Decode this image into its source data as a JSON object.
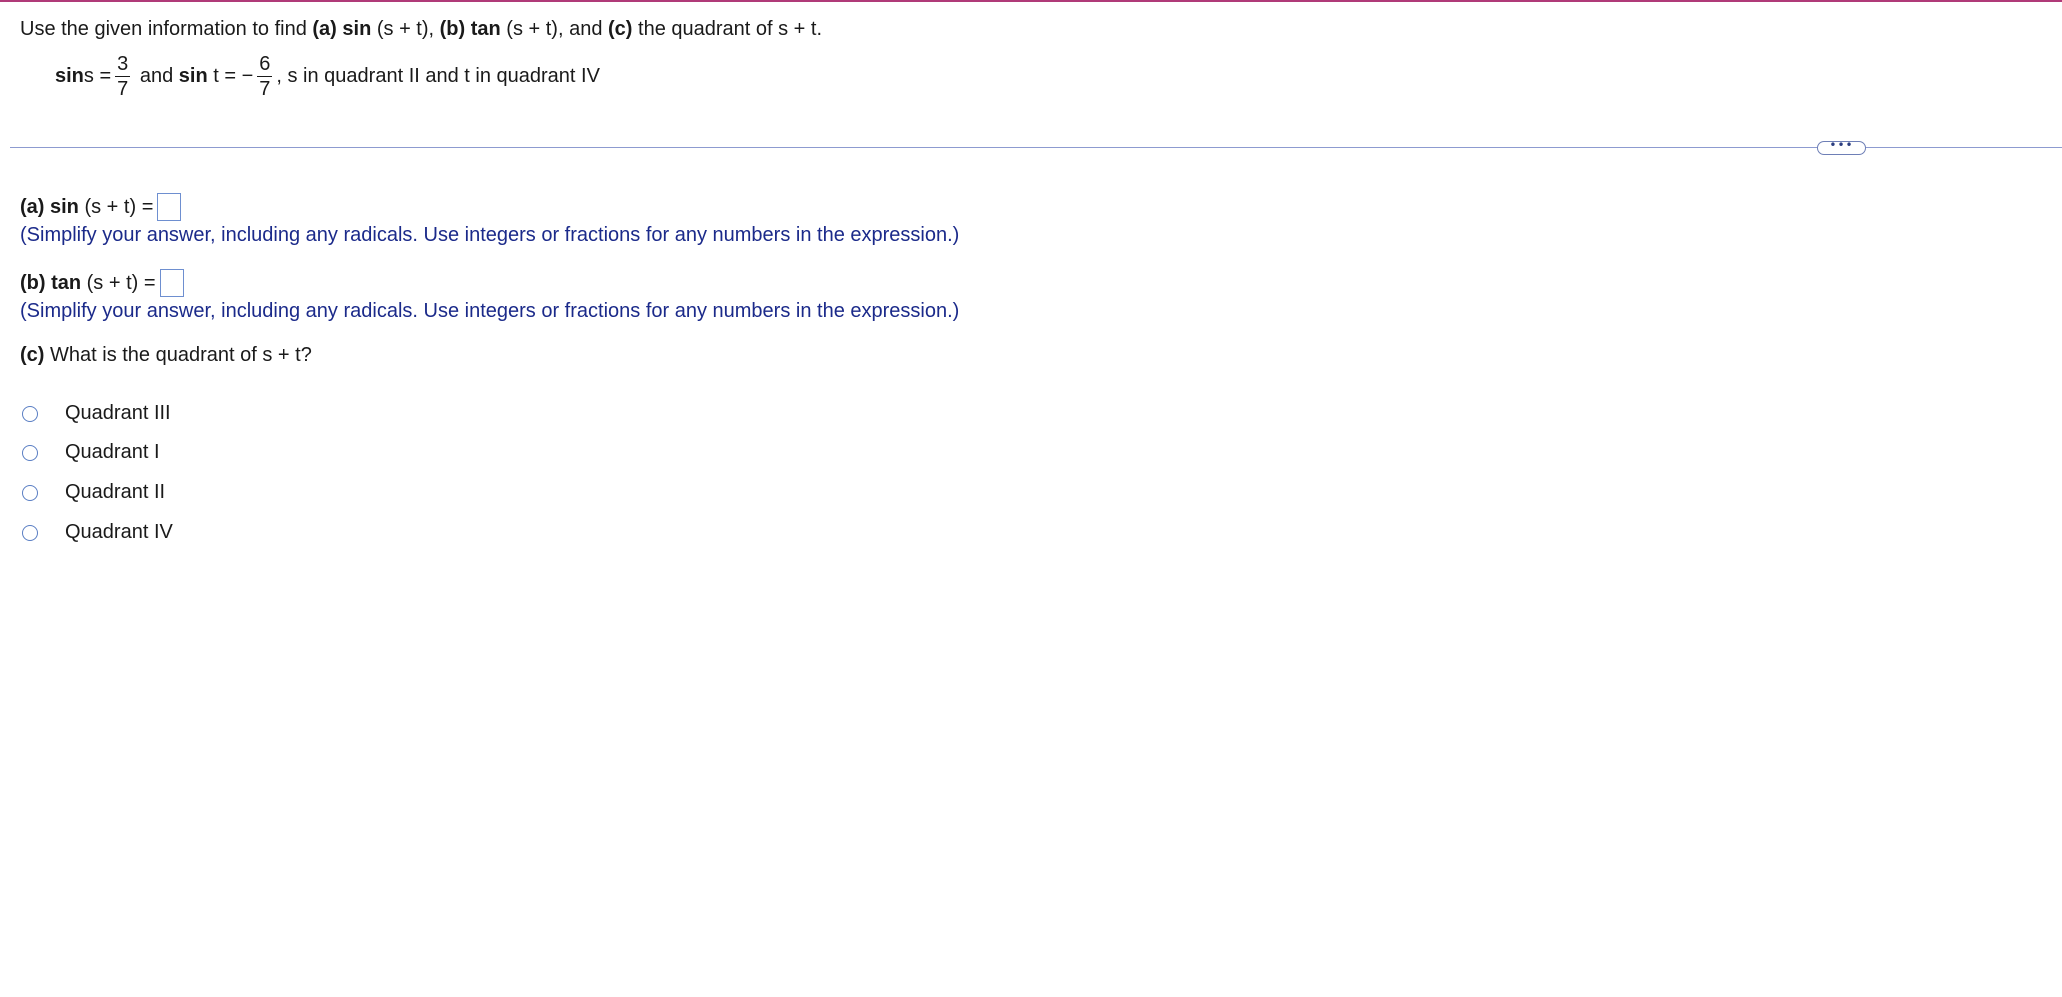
{
  "question": {
    "intro": [
      {
        "text": "Use the given information to find ",
        "bold": false
      },
      {
        "text": "(a) sin",
        "bold": true
      },
      {
        "text": " (s + t), ",
        "bold": false
      },
      {
        "text": "(b) tan",
        "bold": true
      },
      {
        "text": " (s + t), and ",
        "bold": false
      },
      {
        "text": "(c)",
        "bold": true
      },
      {
        "text": " the quadrant of s + t.",
        "bold": false
      }
    ],
    "given": {
      "sin_label_1": "sin",
      "s_eq": " s =",
      "frac1_num": "3",
      "frac1_den": "7",
      "and_text": " and ",
      "sin_label_2": "sin",
      "t_eq": " t = −",
      "frac2_num": "6",
      "frac2_den": "7",
      "tail": ", s in quadrant II and t in quadrant IV"
    }
  },
  "more_button": "•••",
  "part_a": {
    "label": "(a) sin",
    "expr": " (s + t) =",
    "hint": "(Simplify your answer, including any radicals. Use integers or fractions for any numbers in the expression.)"
  },
  "part_b": {
    "label": "(b) tan",
    "expr": " (s + t) =",
    "hint": "(Simplify your answer, including any radicals. Use integers or fractions for any numbers in the expression.)"
  },
  "part_c": {
    "label": "(c)",
    "text": " What is the quadrant of s + t?"
  },
  "choices": [
    {
      "label": "Quadrant III"
    },
    {
      "label": "Quadrant I"
    },
    {
      "label": "Quadrant II"
    },
    {
      "label": "Quadrant IV"
    }
  ]
}
